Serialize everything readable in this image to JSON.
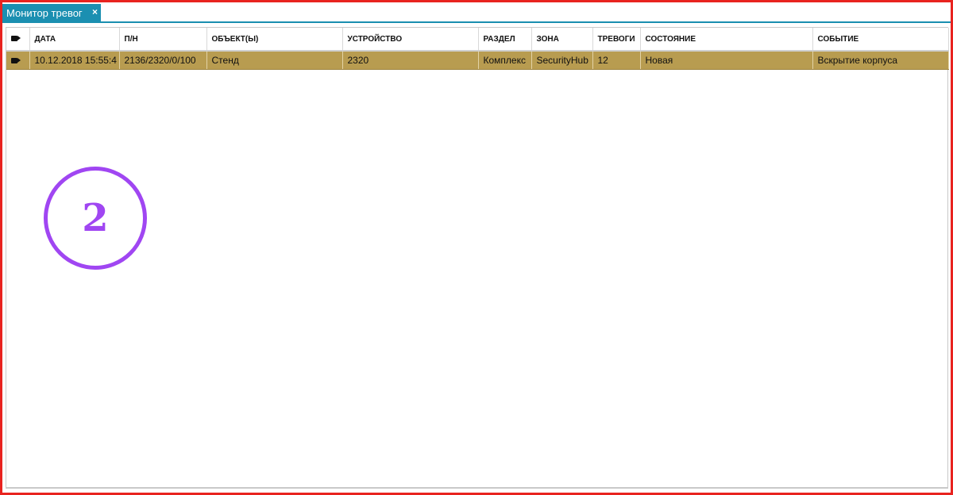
{
  "tab": {
    "title": "Монитор тревог",
    "close": "×"
  },
  "table": {
    "columns": [
      "",
      "ДАТА",
      "П/Н",
      "ОБЪЕКТ(Ы)",
      "УСТРОЙСТВО",
      "РАЗДЕЛ",
      "ЗОНА",
      "ТРЕВОГИ",
      "СОСТОЯНИЕ",
      "СОБЫТИЕ"
    ],
    "rows": [
      {
        "date": "10.12.2018 15:55:4",
        "pn": "2136/2320/0/100",
        "object": "Стенд",
        "device": "2320",
        "section": "Комплекс",
        "zone": "SecurityHub",
        "alarms": "12",
        "state": "Новая",
        "event": "Вскрытие корпуса"
      }
    ]
  },
  "annotation": {
    "number": "2"
  },
  "colors": {
    "accent": "#1b8fb1",
    "row_selected": "#b89c50",
    "frame": "#e8231f",
    "annotation": "#a046f2"
  },
  "icons": {
    "camera": "video-camera-icon"
  }
}
